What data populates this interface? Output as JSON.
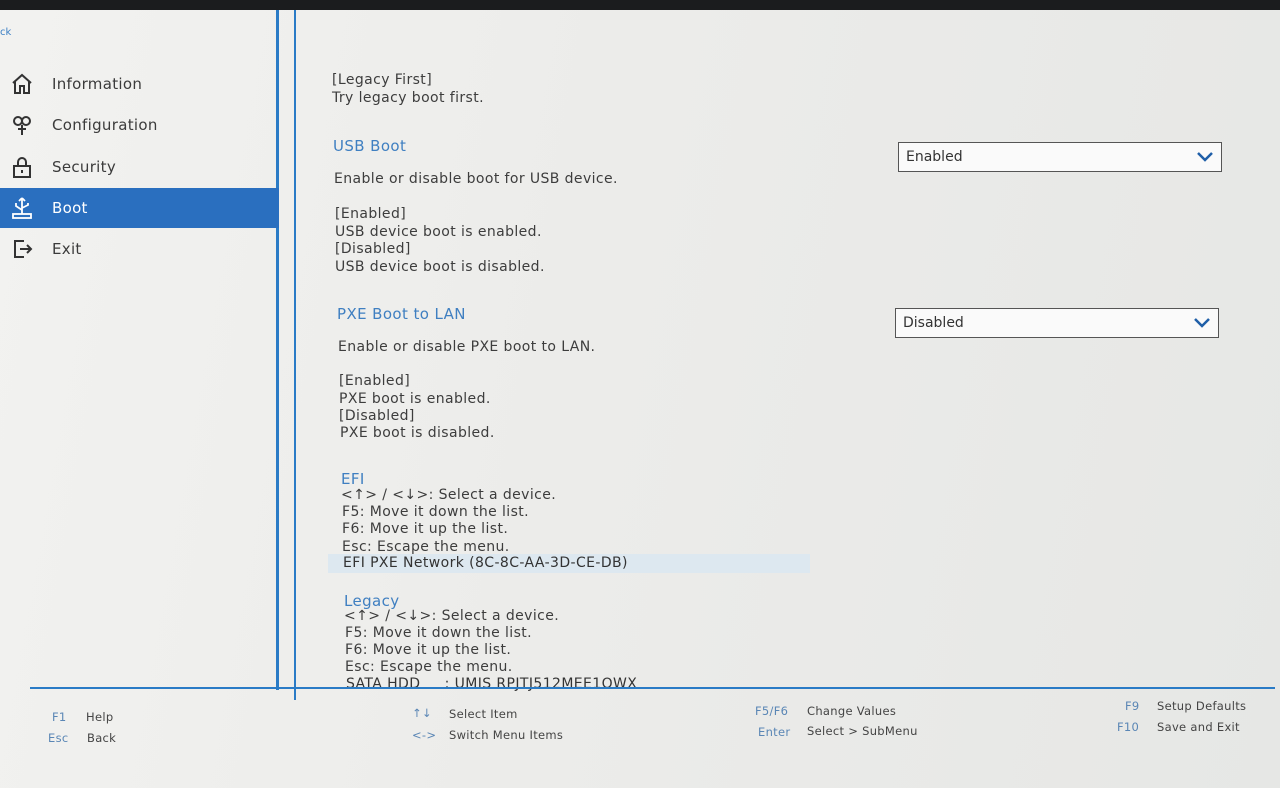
{
  "sidebar": {
    "back_label": "ck",
    "items": [
      {
        "label": "Information",
        "icon": "home-icon",
        "active": false
      },
      {
        "label": "Configuration",
        "icon": "configuration-icon",
        "active": false
      },
      {
        "label": "Security",
        "icon": "lock-icon",
        "active": false
      },
      {
        "label": "Boot",
        "icon": "boot-usb-icon",
        "active": true
      },
      {
        "label": "Exit",
        "icon": "exit-icon",
        "active": false
      }
    ]
  },
  "content": {
    "legacy_first": {
      "tag": "[Legacy First]",
      "desc": "Try legacy boot first."
    },
    "usb_boot": {
      "title": "USB Boot",
      "value": "Enabled",
      "desc": "Enable or disable boot for USB device.",
      "enabled_tag": "[Enabled]",
      "enabled_desc": "USB device boot is enabled.",
      "disabled_tag": "[Disabled]",
      "disabled_desc": "USB device boot is disabled."
    },
    "pxe_boot": {
      "title": "PXE Boot to LAN",
      "value": "Disabled",
      "desc": "Enable or disable PXE boot to LAN.",
      "enabled_tag": "[Enabled]",
      "enabled_desc": "PXE boot is enabled.",
      "disabled_tag": "[Disabled]",
      "disabled_desc": "PXE boot is disabled."
    },
    "efi": {
      "title": "EFI",
      "line1": "<↑> / <↓>: Select a device.",
      "line2": "F5: Move it down the list.",
      "line3": "F6: Move it up the list.",
      "line4": "Esc: Escape the menu.",
      "device": "EFI PXE Network (8C-8C-AA-3D-CE-DB)"
    },
    "legacy": {
      "title": "Legacy",
      "line1": "<↑> / <↓>: Select a device.",
      "line2": "F5: Move it down the list.",
      "line3": "F6: Move it up the list.",
      "line4": "Esc: Escape the menu.",
      "device": "SATA HDD     : UMIS RPJTJ512MEE1OWX"
    }
  },
  "footer": {
    "f1": {
      "key": "F1",
      "label": "Help"
    },
    "esc": {
      "key": "Esc",
      "label": "Back"
    },
    "arrows_ud": {
      "key": "↑↓",
      "label": "Select Item"
    },
    "arrows_lr": {
      "key": "<->",
      "label": "Switch Menu Items"
    },
    "f5f6": {
      "key": "F5/F6",
      "label": "Change Values"
    },
    "enter": {
      "key": "Enter",
      "label": "Select > SubMenu"
    },
    "f9": {
      "key": "F9",
      "label": "Setup Defaults"
    },
    "f10": {
      "key": "F10",
      "label": "Save and Exit"
    }
  },
  "colors": {
    "accent": "#2a6fbf",
    "heading": "#3f7fc1"
  }
}
